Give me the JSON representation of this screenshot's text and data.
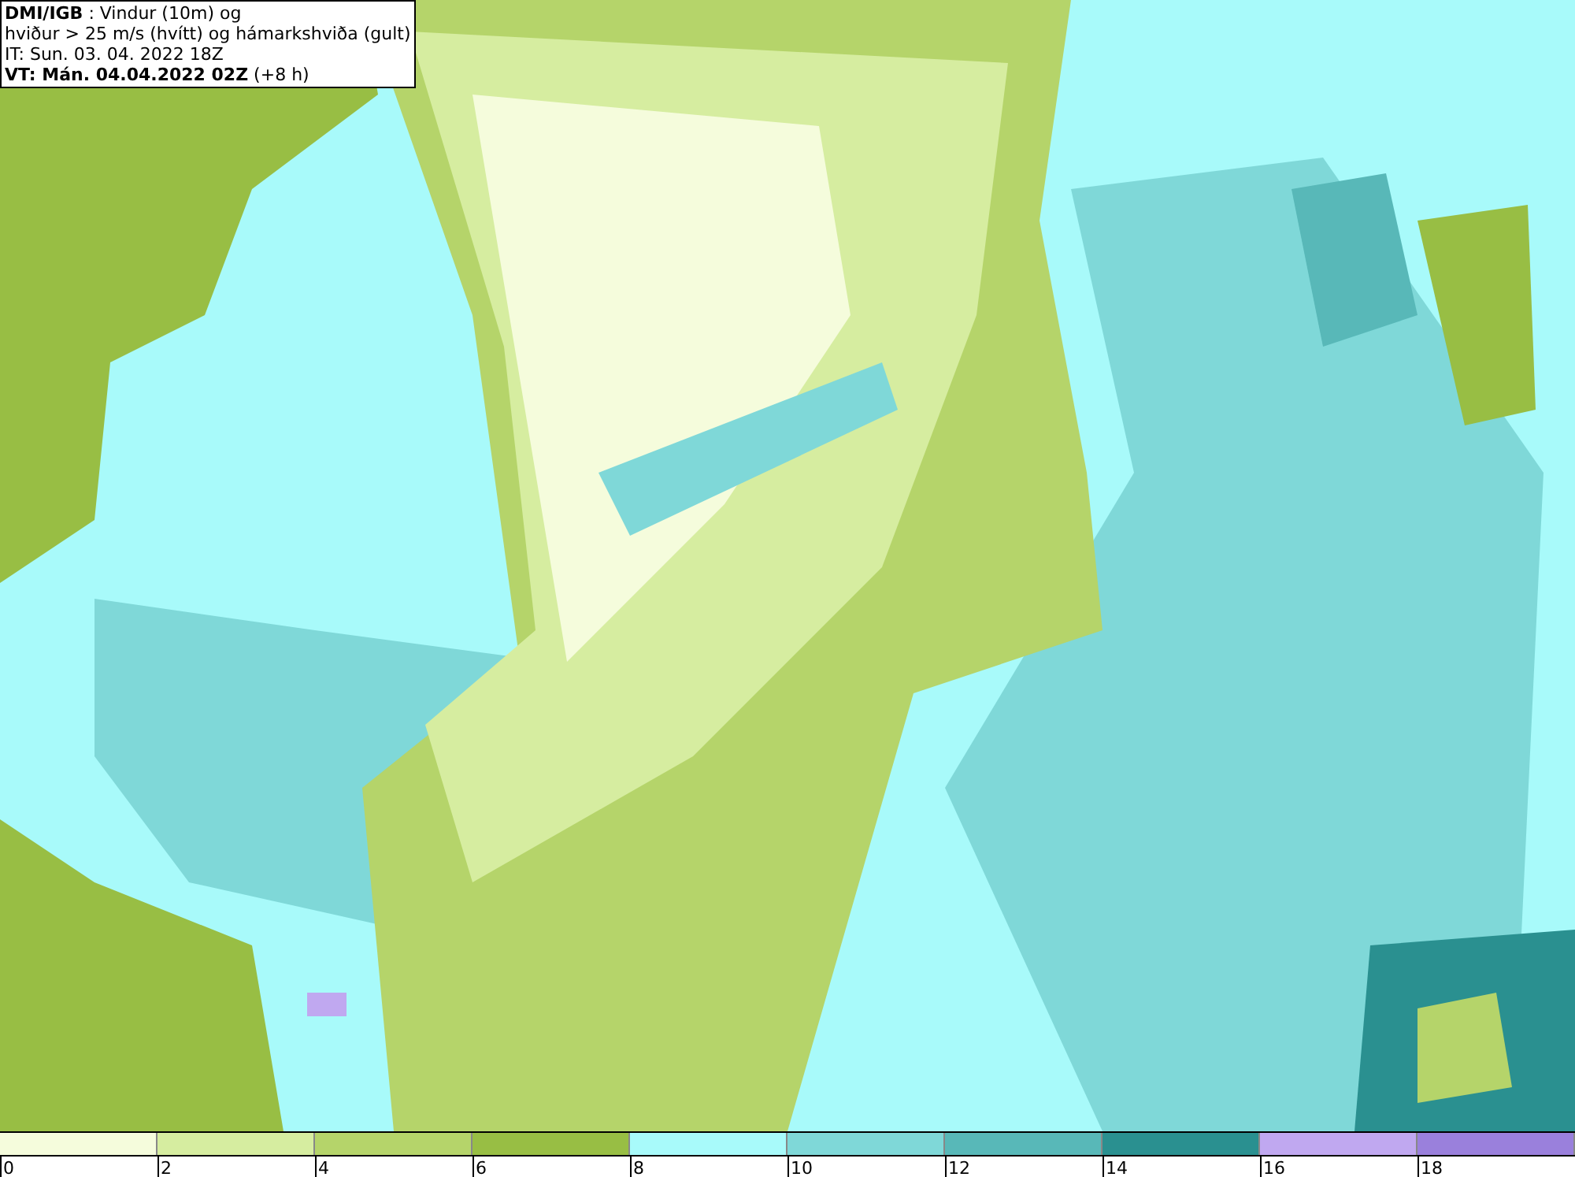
{
  "title_box": {
    "lines": [
      "**DMI/IGB** : Vindur (10m) og",
      "hviður > 25 m/s (hvítt) og hámarkshviða (gult)",
      "IT: Sun. 03. 04. 2022 18Z",
      "**VT: Mán. 04.04.2022 02Z** (+8 h)"
    ]
  },
  "legend": [
    {
      "label": "0",
      "color": "#f5fcdc"
    },
    {
      "label": "2",
      "color": "#d6eda0"
    },
    {
      "label": "4",
      "color": "#b5d46a"
    },
    {
      "label": "6",
      "color": "#98be44"
    },
    {
      "label": "8",
      "color": "#a8fafa"
    },
    {
      "label": "10",
      "color": "#7fd8d8"
    },
    {
      "label": "12",
      "color": "#58b8b8"
    },
    {
      "label": "14",
      "color": "#2a9090"
    },
    {
      "label": "16",
      "color": "#c0a8f0"
    },
    {
      "label": "18",
      "color": "#9a80dc"
    }
  ]
}
